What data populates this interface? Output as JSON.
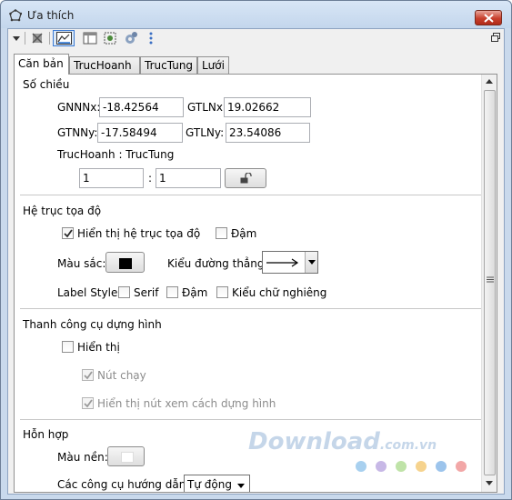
{
  "window": {
    "title": "Ưa thích"
  },
  "toolbar": {
    "icons": [
      "dropdown-arrow-icon",
      "shapes-icon",
      "graphics-view-icon",
      "layout-icon",
      "defaults-icon",
      "settings-icon",
      "more-icon"
    ]
  },
  "tabs": [
    {
      "label": "Căn bản",
      "active": true
    },
    {
      "label": "TrucHoanh",
      "active": false
    },
    {
      "label": "TrucTung",
      "active": false
    },
    {
      "label": "Lưới",
      "active": false
    }
  ],
  "dimensions": {
    "title": "Số chiều",
    "xmin_label": "GNNNx:",
    "xmin_value": "-18.42564",
    "xmax_label": "GTLNx:",
    "xmax_value": "19.02662",
    "ymin_label": "GTNNy:",
    "ymin_value": "-17.58494",
    "ymax_label": "GTLNy:",
    "ymax_value": "23.54086",
    "ratio_label": "TrucHoanh : TrucTung",
    "ratio_x": "1",
    "ratio_sep": ":",
    "ratio_y": "1"
  },
  "axes": {
    "title": "Hệ trục tọa độ",
    "show_axes_label": "Hiển thị hệ trục tọa độ",
    "show_axes_checked": true,
    "bold_label": "Đậm",
    "bold_checked": false,
    "color_label": "Màu sắc:",
    "color_value": "#000000",
    "line_style_label": "Kiểu đường thẳng:",
    "label_style_label": "Label Style",
    "serif_label": "Serif",
    "label_bold_label": "Đậm",
    "italic_label": "Kiểu chữ nghiêng"
  },
  "construction_bar": {
    "title": "Thanh công cụ dựng hình",
    "show_label": "Hiển thị",
    "show_checked": false,
    "play_button_label": "Nút chạy",
    "play_button_checked": true,
    "show_protocol_button_label": "Hiển thị nút xem cách dựng hình",
    "show_protocol_button_checked": true
  },
  "misc": {
    "title": "Hỗn hợp",
    "bg_color_label": "Màu nền:",
    "bg_color_value": "#ffffff",
    "tooltips_label": "Các công cụ hướng dẫn:",
    "tooltips_value": "Tự động"
  },
  "watermark": {
    "text": "Download",
    "suffix": ".com.vn"
  },
  "colors": {
    "accent": "#3a7bd5",
    "titlebar": "#c9d9ec",
    "close": "#c8402d"
  }
}
